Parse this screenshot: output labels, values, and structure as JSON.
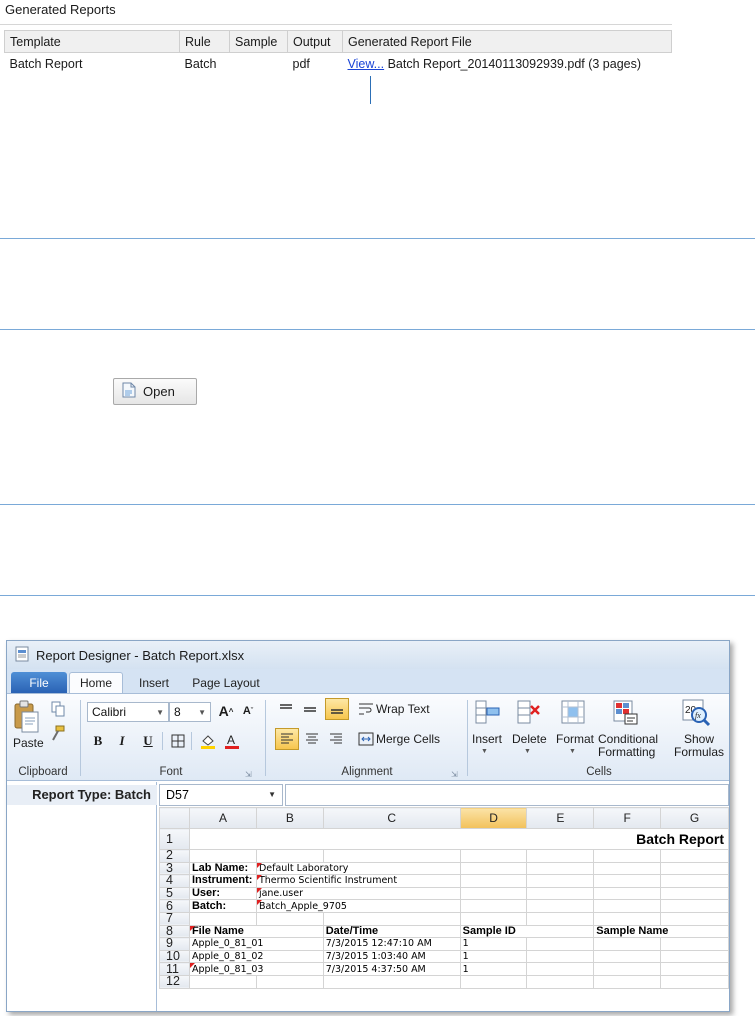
{
  "generated_reports": {
    "title": "Generated Reports",
    "columns": [
      "Template",
      "Rule",
      "Sample",
      "Output",
      "Generated Report File"
    ],
    "row": {
      "template": "Batch Report",
      "rule": "Batch",
      "sample": "",
      "output": "pdf",
      "view_link": "View...",
      "file": " Batch Report_20140113092939.pdf (3 pages)"
    }
  },
  "open_button": {
    "label": "Open"
  },
  "designer": {
    "window_title": "Report Designer - Batch Report.xlsx",
    "tabs": [
      "File",
      "Home",
      "Insert",
      "Page Layout"
    ],
    "ribbon": {
      "paste": "Paste",
      "font_name": "Calibri",
      "font_size": "8",
      "wrap_text": "Wrap Text",
      "merge_cells": "Merge Cells",
      "insert": "Insert",
      "delete": "Delete",
      "format": "Format",
      "conditional_formatting_1": "Conditional",
      "conditional_formatting_2": "Formatting",
      "show_formulas_1": "Show",
      "show_formulas_2": "Formulas",
      "groups": [
        "Clipboard",
        "Font",
        "Alignment",
        "Cells"
      ]
    },
    "report_type": "Report Type: Batch",
    "name_box": "D57",
    "columns": [
      "A",
      "B",
      "C",
      "D",
      "E",
      "F",
      "G"
    ],
    "rows": [
      {
        "n": "1",
        "title": "Batch Report"
      },
      {
        "n": "2"
      },
      {
        "n": "3",
        "label": "Lab Name:",
        "value": "Default Laboratory"
      },
      {
        "n": "4",
        "label": "Instrument:",
        "value": "Thermo Scientific Instrument"
      },
      {
        "n": "5",
        "label": "User:",
        "value": "jane.user"
      },
      {
        "n": "6",
        "label": "Batch:",
        "value": "Batch_Apple_9705"
      },
      {
        "n": "7"
      },
      {
        "n": "8",
        "h1": "File Name",
        "h2": "Date/Time",
        "h3": "Sample ID",
        "h4": "Sample Name"
      },
      {
        "n": "9",
        "file": "Apple_0_81_01",
        "dt": "7/3/2015 12:47:10 AM",
        "id": "1"
      },
      {
        "n": "10",
        "file": "Apple_0_81_02",
        "dt": "7/3/2015 1:03:40 AM",
        "id": "1"
      },
      {
        "n": "11",
        "file": "Apple_0_81_03",
        "dt": "7/3/2015 4:37:50 AM",
        "id": "1"
      },
      {
        "n": "12"
      }
    ]
  }
}
